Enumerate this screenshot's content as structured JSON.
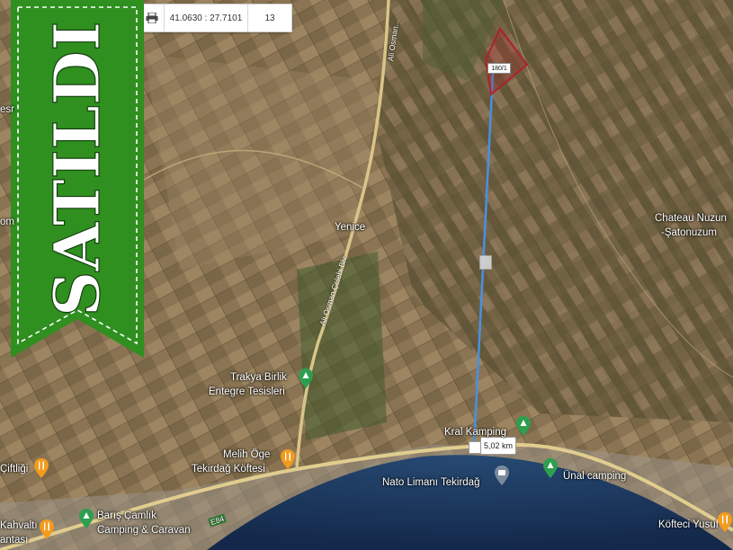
{
  "toolbar": {
    "print_icon": "printer-icon",
    "coordinates": "41.0630 : 27.7101",
    "zoom": "13"
  },
  "banner": {
    "text": "SATILDI",
    "color": "#2f8f1f"
  },
  "measure": {
    "distance_label": "5,02 km",
    "parcel_label": "180/1",
    "line_color": "#4a90e2",
    "parcel_color": "#b0202a"
  },
  "places": {
    "yenice": "Yenice",
    "chateau": "Chateau Nuzun",
    "satonuzum": "-Şatonuzum",
    "trakya_1": "Trakya Birlik",
    "trakya_2": "Entegre Tesisleri",
    "kral": "Kral Kamping",
    "melih_1": "Melih Öge",
    "melih_2": "Tekirdağ Köftesi",
    "nato": "Nato Limanı Tekirdağ",
    "unal": "Ünal camping",
    "barish_1": "Barış Çamlık",
    "barish_2": "Camping & Caravan",
    "koftec": "Köfteci Yusuf",
    "ciftligi": "Çiftliği",
    "kahvalti_1": "Kahvaltı",
    "kahvalti_2": "antası",
    "esr": "esr",
    "om": "om"
  },
  "roads": {
    "ali_osman_1": "Ali Osman Çelebi Blv.",
    "ali_osman_2": "Ali Osman...",
    "e84": "E84"
  }
}
